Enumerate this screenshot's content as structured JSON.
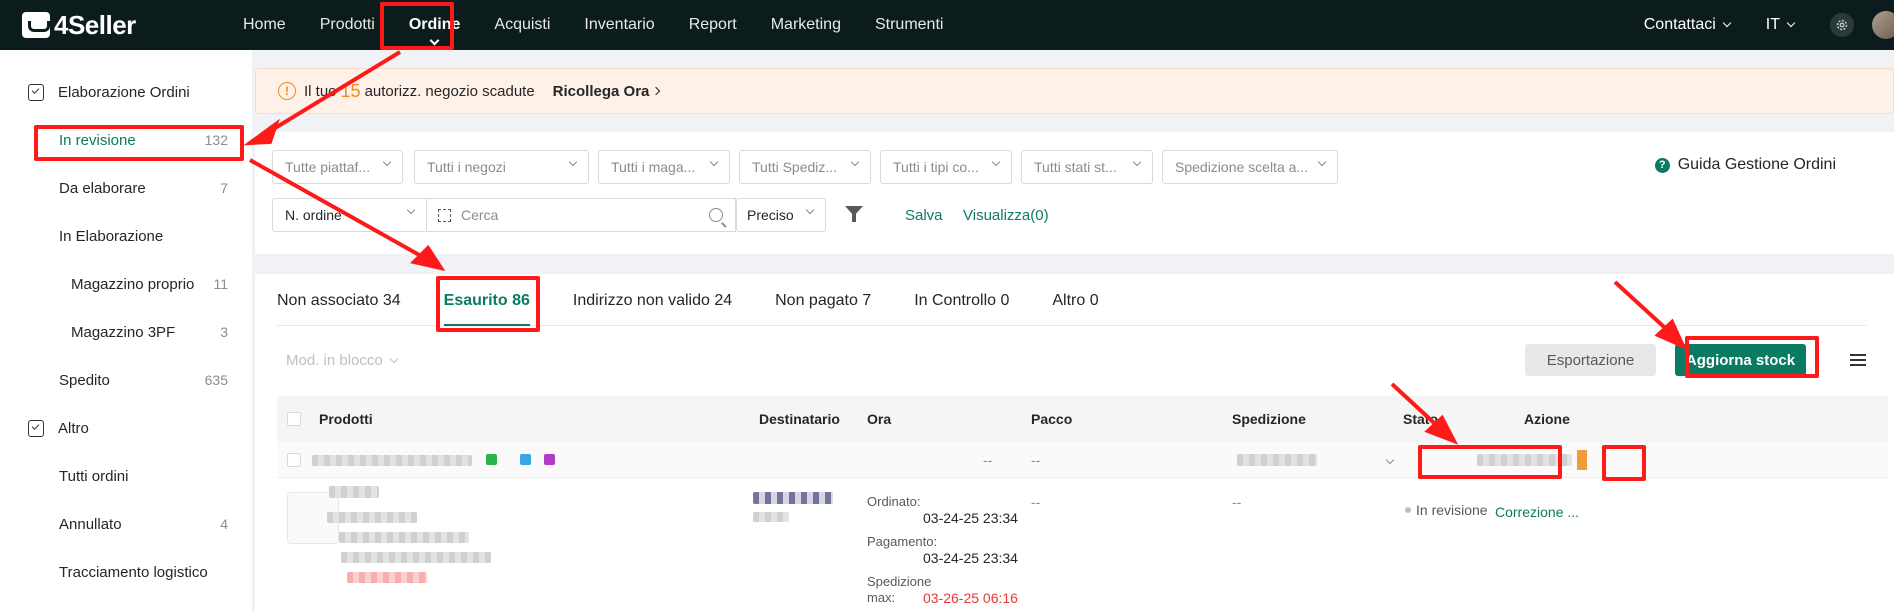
{
  "app": {
    "brand": "4Seller"
  },
  "nav": {
    "items": [
      "Home",
      "Prodotti",
      "Ordine",
      "Acquisti",
      "Inventario",
      "Report",
      "Marketing",
      "Strumenti"
    ],
    "active": "Ordine",
    "contact": "Contattaci",
    "lang": "IT"
  },
  "sidebar": {
    "group1": "Elaborazione Ordini",
    "items": [
      {
        "label": "In revisione",
        "count": "132"
      },
      {
        "label": "Da elaborare",
        "count": "7"
      },
      {
        "label": "In Elaborazione",
        "count": ""
      },
      {
        "label": "Magazzino proprio",
        "count": "11"
      },
      {
        "label": "Magazzino 3PF",
        "count": "3"
      },
      {
        "label": "Spedito",
        "count": "635"
      }
    ],
    "group2": "Altro",
    "items2": [
      {
        "label": "Tutti ordini",
        "count": ""
      },
      {
        "label": "Annullato",
        "count": "4"
      },
      {
        "label": "Tracciamento logistico",
        "count": ""
      }
    ]
  },
  "banner": {
    "pre": "Il tuo",
    "number": "15",
    "post": "autorizz. negozio scadute",
    "link": "Ricollega Ora"
  },
  "filters": {
    "selects": [
      "Tutte piattaf...",
      "Tutti i negozi",
      "Tutti i maga...",
      "Tutti Spediz...",
      "Tutti i tipi co...",
      "Tutti stati st...",
      "Spedizione scelta a..."
    ],
    "guide": "Guida Gestione Ordini",
    "field_type": "N. ordine",
    "search_placeholder": "Cerca",
    "match": "Preciso",
    "save": "Salva",
    "view": "Visualizza(0)"
  },
  "tabs": [
    {
      "label": "Non associato 34"
    },
    {
      "label": "Esaurito 86"
    },
    {
      "label": "Indirizzo non valido 24"
    },
    {
      "label": "Non pagato 7"
    },
    {
      "label": "In Controllo 0"
    },
    {
      "label": "Altro 0"
    }
  ],
  "toolbar": {
    "bulk": "Mod. in blocco",
    "export": "Esportazione",
    "update_stock": "Aggiorna stock"
  },
  "table": {
    "columns": [
      "Prodotti",
      "Destinatario",
      "Ora",
      "Pacco",
      "Spedizione",
      "Stato",
      "Azione"
    ],
    "group_row": {
      "ora": "--",
      "pacco": "--"
    },
    "row": {
      "ordered_label": "Ordinato:",
      "ordered_value": "03-24-25 23:34",
      "paid_label": "Pagamento:",
      "paid_value": "03-24-25 23:34",
      "ship_label": "Spedizione max:",
      "ship_value": "03-26-25 06:16",
      "pacco": "--",
      "spedizione": "--",
      "status": "In revisione",
      "action": "Correzione ..."
    }
  },
  "colors": {
    "accent": "#0b7a63",
    "warning": "#f08c1e",
    "annotation": "#ff1a1a"
  }
}
